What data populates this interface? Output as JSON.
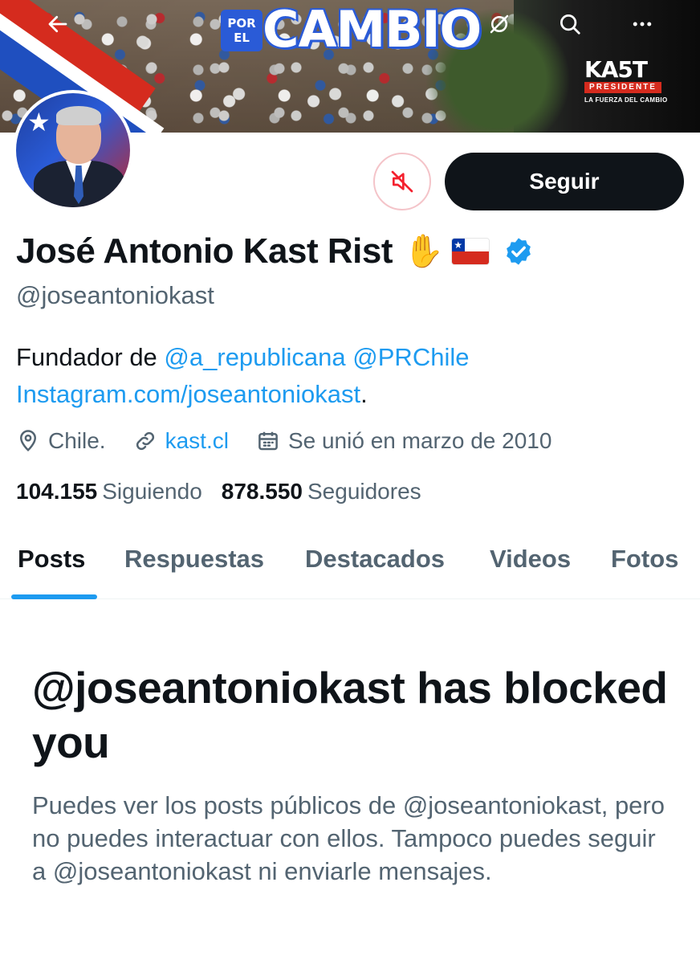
{
  "banner": {
    "slogan_small": "POR EL",
    "slogan_main": "CAMBIO",
    "brand_name": "KA5T",
    "brand_sub": "PRESIDENTE",
    "brand_tag": "LA FUERZA DEL CAMBIO"
  },
  "header_icons": [
    "back-arrow-icon",
    "no-grok-icon",
    "search-icon",
    "more-icon"
  ],
  "profile": {
    "display_name": "José Antonio Kast Rist",
    "emoji": "✋",
    "handle": "@joseantoniokast",
    "bio_prefix": "Fundador de ",
    "bio_mention_1": "@a_republicana",
    "bio_mention_2": "@PRChile",
    "bio_link": "Instagram.com/joseantoniokast",
    "bio_suffix": ".",
    "location": "Chile.",
    "website": "kast.cl",
    "joined": "Se unió en marzo de 2010",
    "following_count": "104.155",
    "following_label": "Siguiendo",
    "followers_count": "878.550",
    "followers_label": "Seguidores"
  },
  "actions": {
    "follow_label": "Seguir",
    "mute_icon": "muted-speaker-icon"
  },
  "tabs": [
    {
      "label": "Posts",
      "active": true
    },
    {
      "label": "Respuestas",
      "active": false
    },
    {
      "label": "Destacados",
      "active": false
    },
    {
      "label": "Videos",
      "active": false
    },
    {
      "label": "Fotos",
      "active": false
    }
  ],
  "blocked": {
    "title": "@joseantoniokast has blocked you",
    "body": "Puedes ver los posts públicos de @joseantoniokast, pero no puedes interactuar con ellos. Tampoco puedes seguir a @joseantoniokast ni enviarle mensajes."
  },
  "colors": {
    "accent": "#1d9bf0",
    "text": "#0f1419",
    "muted": "#536471",
    "follow_bg": "#0f1419",
    "mute_border": "#f4c4c9",
    "mute_icon": "#f4212e"
  }
}
